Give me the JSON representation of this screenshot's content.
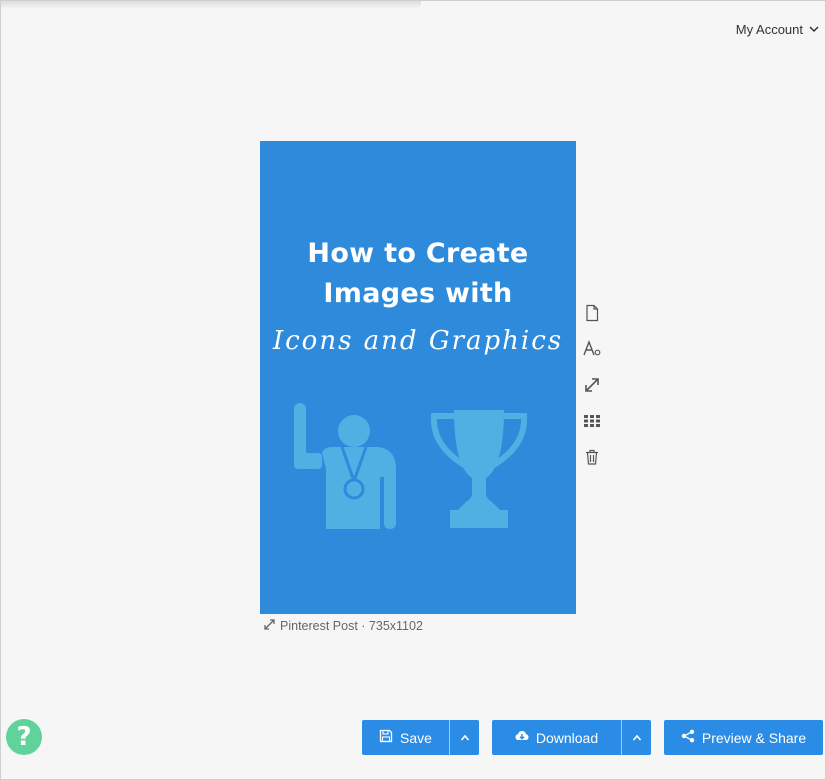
{
  "header": {
    "account_label": "My Account"
  },
  "design": {
    "title_line1": "How to Create",
    "title_line2": "Images with",
    "script_line": "Icons and Graphics",
    "background_color": "#2e8bdb",
    "graphic_color": "#4fb0e3",
    "graphics": [
      "athlete-medal-icon",
      "trophy-icon"
    ]
  },
  "canvas_info": {
    "label": "Pinterest Post · 735x1102"
  },
  "side_tools": [
    "page-icon",
    "text-style-icon",
    "resize-icon",
    "grid-icon",
    "trash-icon"
  ],
  "footer": {
    "save_label": "Save",
    "download_label": "Download",
    "share_label": "Preview & Share",
    "help_label": "?"
  },
  "colors": {
    "button": "#2b8ce6",
    "help": "#5fd39b"
  }
}
